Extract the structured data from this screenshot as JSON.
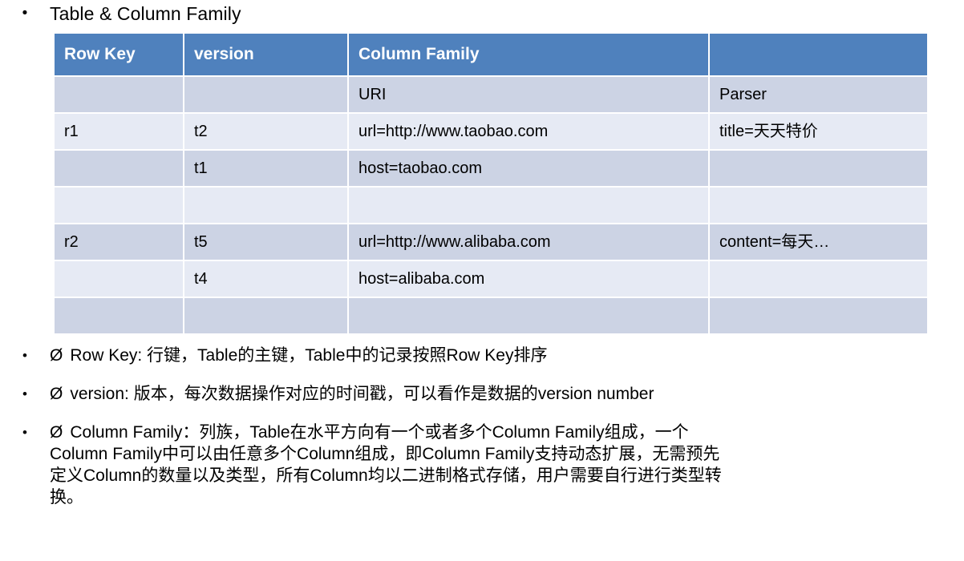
{
  "slide": {
    "heading": {
      "bullet_glyph": "•",
      "text": "Table & Column Family"
    },
    "table": {
      "header_bg": "#4f81bd",
      "band_dark": "#ccd3e4",
      "band_light": "#e6eaf4",
      "columns": [
        "Row Key",
        "version",
        "Column Family",
        ""
      ],
      "rows": [
        {
          "band": "dark",
          "cells": [
            "",
            "",
            "URI",
            "Parser"
          ]
        },
        {
          "band": "light",
          "cells": [
            "r1",
            "t2",
            "url=http://www.taobao.com",
            "title=天天特价"
          ]
        },
        {
          "band": "dark",
          "cells": [
            "",
            "t1",
            "host=taobao.com",
            ""
          ]
        },
        {
          "band": "light",
          "cells": [
            "",
            "",
            "",
            ""
          ]
        },
        {
          "band": "dark",
          "cells": [
            "r2",
            "t5",
            "url=http://www.alibaba.com",
            "content=每天…"
          ]
        },
        {
          "band": "light",
          "cells": [
            "",
            "t4",
            "host=alibaba.com",
            ""
          ]
        },
        {
          "band": "dark",
          "cells": [
            "",
            "",
            "",
            ""
          ]
        }
      ]
    },
    "bullets": [
      {
        "bullet_glyph": "•",
        "sub_glyph": "Ø",
        "lines": [
          "Row Key: 行键，Table的主键，Table中的记录按照Row Key排序"
        ]
      },
      {
        "bullet_glyph": "•",
        "sub_glyph": "Ø",
        "lines": [
          "version: 版本，每次数据操作对应的时间戳，可以看作是数据的version number"
        ]
      },
      {
        "bullet_glyph": "•",
        "sub_glyph": "Ø",
        "lines": [
          "Column Family：列族，Table在水平方向有一个或者多个Column Family组成，一个",
          "Column Family中可以由任意多个Column组成，即Column Family支持动态扩展，无需预先",
          "定义Column的数量以及类型，所有Column均以二进制格式存储，用户需要自行进行类型转",
          "换。"
        ]
      }
    ]
  }
}
